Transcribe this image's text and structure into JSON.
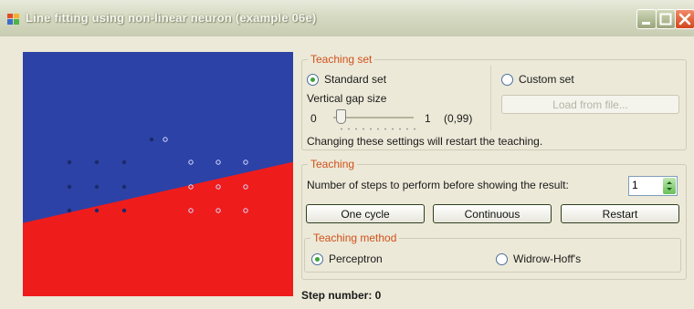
{
  "window": {
    "title": "Line fitting using non-linear neuron (example 06e)",
    "accent_color": "#d0521c"
  },
  "plot": {
    "blue_color": "#2c42a6",
    "red_color": "#ef1c1c",
    "boundary_line": {
      "from_y_at_left": 0.7,
      "to_y_at_right": 0.45
    }
  },
  "teaching_set": {
    "legend": "Teaching set",
    "standard_label": "Standard set",
    "custom_label": "Custom set",
    "gap_label": "Vertical gap size",
    "slider_min_label": "0",
    "slider_max_label": "1",
    "slider_value_label": "(0,99)",
    "slider_value": 0.01,
    "load_button_label": "Load from file...",
    "note": "Changing these settings will restart the teaching."
  },
  "teaching": {
    "legend": "Teaching",
    "steps_label": "Number of steps to perform before showing the result:",
    "steps_value": "1",
    "one_cycle_label": "One cycle",
    "continuous_label": "Continuous",
    "restart_label": "Restart"
  },
  "method": {
    "legend": "Teaching method",
    "perceptron_label": "Perceptron",
    "widrow_label": "Widrow-Hoff's"
  },
  "status": {
    "step_text": "Step number: 0"
  },
  "icons": {
    "app": "app-icon",
    "minimize": "minimize-icon",
    "maximize": "maximize-icon",
    "close": "close-icon"
  }
}
